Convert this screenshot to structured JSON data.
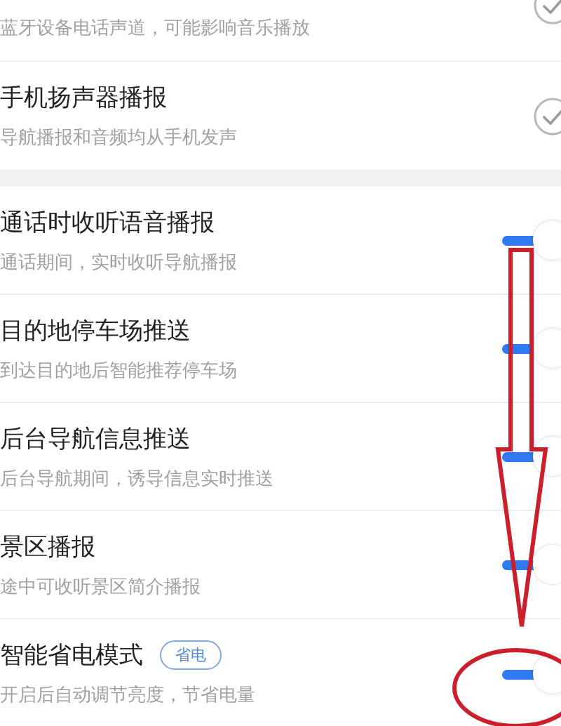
{
  "settings_groups": [
    {
      "items": [
        {
          "kind": "check",
          "subtitle": "蓝牙设备电话声道，可能影响音乐播放",
          "checked": true
        },
        {
          "kind": "check",
          "title": "手机扬声器播报",
          "subtitle": "导航播报和音频均从手机发声",
          "checked": true
        }
      ]
    },
    {
      "items": [
        {
          "kind": "toggle",
          "title": "通话时收听语音播报",
          "subtitle": "通话期间，实时收听导航播报",
          "on": true
        },
        {
          "kind": "toggle",
          "title": "目的地停车场推送",
          "subtitle": "到达目的地后智能推荐停车场",
          "on": true
        },
        {
          "kind": "toggle",
          "title": "后台导航信息推送",
          "subtitle": "后台导航期间，诱导信息实时推送",
          "on": true
        },
        {
          "kind": "toggle",
          "title": "景区播报",
          "subtitle": "途中可收听景区简介播报",
          "on": true
        },
        {
          "kind": "toggle",
          "title": "智能省电模式",
          "badge": "省电",
          "subtitle": "开启后自动调节亮度，节省电量",
          "on": true
        }
      ]
    }
  ]
}
